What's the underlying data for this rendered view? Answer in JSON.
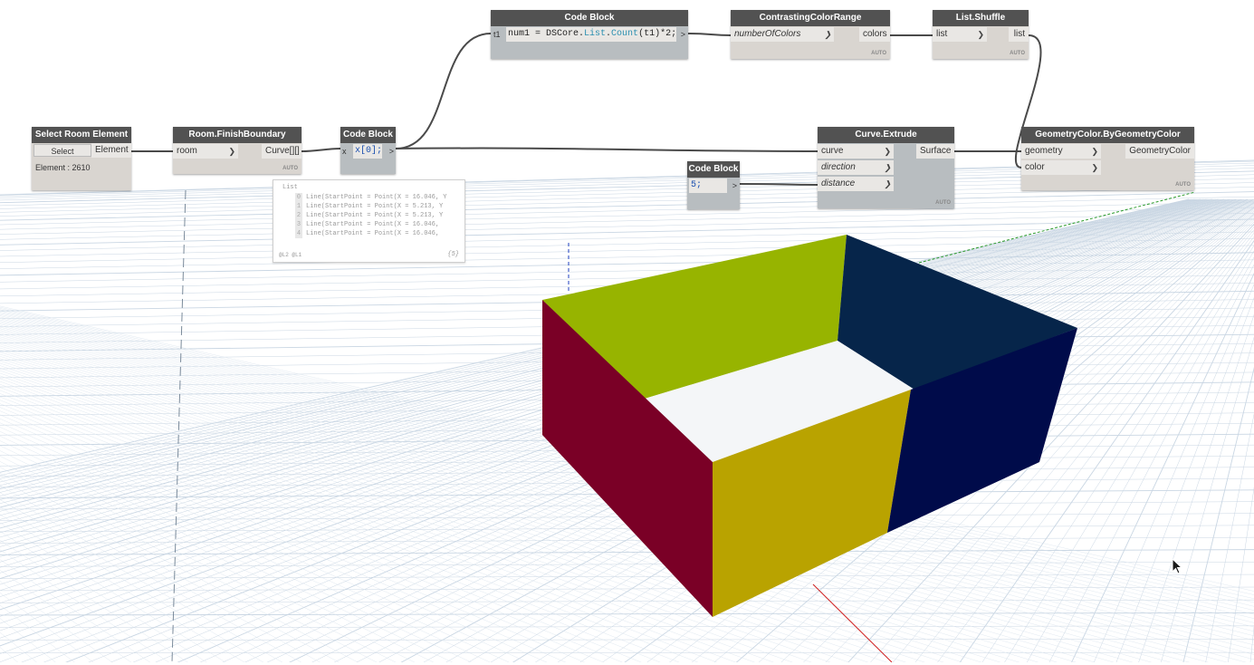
{
  "nodes": {
    "select_room": {
      "title": "Select Room Element",
      "button": "Select",
      "output": "Element",
      "status": "Element : 2610"
    },
    "finish_boundary": {
      "title": "Room.FinishBoundary",
      "input": "room",
      "output": "Curve[][]",
      "auto": "AUTO"
    },
    "code_block_index": {
      "title": "Code Block",
      "input": "x",
      "code": "x[0];",
      "output": ">"
    },
    "code_block_count": {
      "title": "Code Block",
      "input": "t1",
      "code_prefix": "num1 = DSCore.",
      "code_keyword": "List",
      "code_dot": ".",
      "code_method": "Count",
      "code_suffix": "(t1)*2;",
      "output": ">"
    },
    "contrasting": {
      "title": "ContrastingColorRange",
      "input": "numberOfColors",
      "output": "colors",
      "auto": "AUTO"
    },
    "shuffle": {
      "title": "List.Shuffle",
      "input": "list",
      "output": "list",
      "auto": "AUTO"
    },
    "extrude": {
      "title": "Curve.Extrude",
      "inputs": [
        "curve",
        "direction",
        "distance"
      ],
      "output": "Surface",
      "auto": "AUTO"
    },
    "code_block_five": {
      "title": "Code Block",
      "code": "5;",
      "output": ">"
    },
    "geometry_color": {
      "title": "GeometryColor.ByGeometryColor",
      "inputs": [
        "geometry",
        "color"
      ],
      "output": "GeometryColor",
      "auto": "AUTO"
    }
  },
  "preview": {
    "label": "List",
    "rows": [
      {
        "index": "0",
        "text": "Line(StartPoint = Point(X = 16.046, Y"
      },
      {
        "index": "1",
        "text": "Line(StartPoint = Point(X = 5.213, Y"
      },
      {
        "index": "2",
        "text": "Line(StartPoint = Point(X = 5.213, Y"
      },
      {
        "index": "3",
        "text": "Line(StartPoint = Point(X = 16.046,"
      },
      {
        "index": "4",
        "text": "Line(StartPoint = Point(X = 16.046,"
      }
    ],
    "levels": "@L2 @L1",
    "count": "{5}"
  },
  "colors": {
    "wall_front_left": "#7a0026",
    "wall_front_right": "#b9a300",
    "wall_back_left": "#97b400",
    "wall_back_right": "#06254a",
    "wall_right": "#000b4a",
    "node_header": "#525252",
    "wire": "#4a4a4a",
    "grid": "#c9d6e3"
  }
}
